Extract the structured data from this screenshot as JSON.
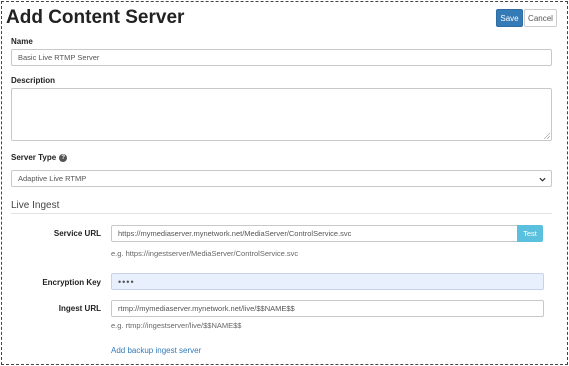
{
  "page": {
    "title": "Add Content Server"
  },
  "toolbar": {
    "save_label": "Save",
    "cancel_label": "Cancel"
  },
  "form": {
    "name": {
      "label": "Name",
      "value": "Basic Live RTMP Server"
    },
    "description": {
      "label": "Description",
      "value": ""
    },
    "server_type": {
      "label": "Server Type",
      "value": "Adaptive Live RTMP",
      "help_icon": "question-circle-icon"
    }
  },
  "live_ingest": {
    "section_title": "Live Ingest",
    "service_url": {
      "label": "Service URL",
      "value": "https://mymediaserver.mynetwork.net/MediaServer/ControlService.svc",
      "hint": "e.g. https://ingestserver/MediaServer/ControlService.svc",
      "test_label": "Test"
    },
    "encryption_key": {
      "label": "Encryption Key",
      "value": "••••"
    },
    "ingest_url": {
      "label": "Ingest URL",
      "value": "rtmp://mymediaserver.mynetwork.net/live/$$NAME$$",
      "hint": "e.g. rtmp://ingestserver/live/$$NAME$$"
    },
    "add_backup_label": "Add backup ingest server"
  },
  "colors": {
    "primary": "#337ab7",
    "info": "#5bc0de",
    "autofill": "#e8f0fe"
  }
}
